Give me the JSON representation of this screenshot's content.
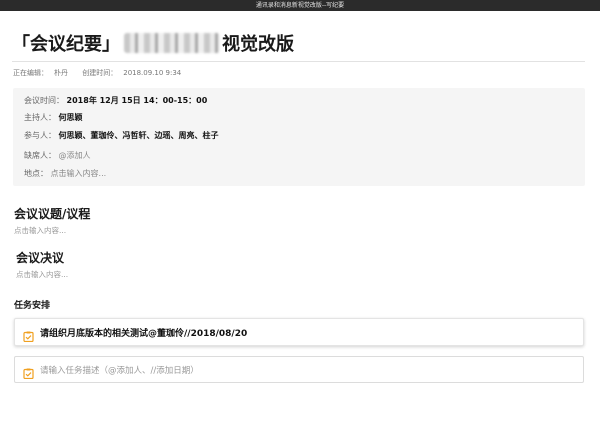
{
  "window": {
    "title": "通讯录和消息新视觉改版--写纪要"
  },
  "doc": {
    "title_prefix": "「会议纪要」",
    "title_suffix": "视觉改版",
    "meta": {
      "editor_label": "正在编辑：",
      "editor_name": "朴丹",
      "created_label": "创建时间：",
      "created_value": "2018.09.10   9:34"
    }
  },
  "info": {
    "time_label": "会议时间：",
    "time_value": "2018年 12月 15日      14：00-15：00",
    "host_label": "主持人：",
    "host_value": "何思颖",
    "attendees_label": "参与人：",
    "attendees_value": "何思颖、董珈伶、冯哲轩、边瑶、周亮、柱子",
    "absent_label": "缺席人：",
    "absent_placeholder": "@添加人",
    "location_label": "地点：",
    "location_placeholder": "点击输入内容..."
  },
  "sections": {
    "agenda_title": "会议议题/议程",
    "agenda_placeholder": "点击输入内容...",
    "resolution_title": "会议决议",
    "resolution_placeholder": "点击输入内容..."
  },
  "tasks": {
    "title": "任务安排",
    "items": [
      {
        "text": "请组织月底版本的相关测试@董珈伶//2018/08/20"
      }
    ],
    "input_placeholder": "请输入任务描述（@添加人、//添加日期）"
  },
  "colors": {
    "accent": "#f0a020"
  },
  "icons": {
    "task": "clipboard-check-icon"
  }
}
